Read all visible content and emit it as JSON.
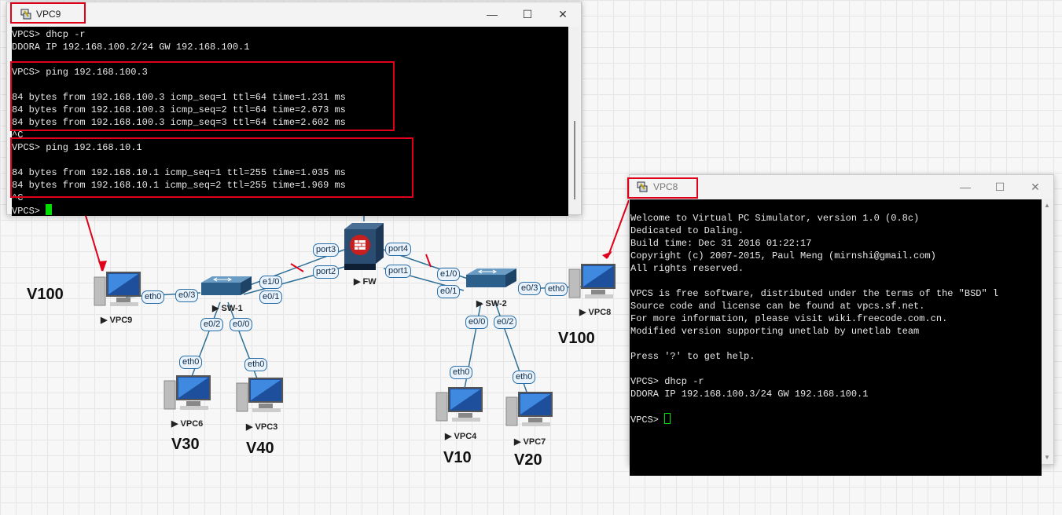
{
  "vpc9_window": {
    "title": "VPC9",
    "lines": [
      "VPCS> dhcp -r",
      "DDORA IP 192.168.100.2/24 GW 192.168.100.1",
      "",
      "VPCS> ping 192.168.100.3",
      "",
      "84 bytes from 192.168.100.3 icmp_seq=1 ttl=64 time=1.231 ms",
      "84 bytes from 192.168.100.3 icmp_seq=2 ttl=64 time=2.673 ms",
      "84 bytes from 192.168.100.3 icmp_seq=3 ttl=64 time=2.602 ms",
      "^C",
      "VPCS> ping 192.168.10.1",
      "",
      "84 bytes from 192.168.10.1 icmp_seq=1 ttl=255 time=1.035 ms",
      "84 bytes from 192.168.10.1 icmp_seq=2 ttl=255 time=1.969 ms",
      "^C"
    ],
    "prompt": "VPCS> ",
    "cursor_color": "#00dd00"
  },
  "vpc8_window": {
    "title": "VPC8",
    "lines": [
      "Welcome to Virtual PC Simulator, version 1.0 (0.8c)",
      "Dedicated to Daling.",
      "Build time: Dec 31 2016 01:22:17",
      "Copyright (c) 2007-2015, Paul Meng (mirnshi@gmail.com)",
      "All rights reserved.",
      "",
      "VPCS is free software, distributed under the terms of the \"BSD\" l",
      "Source code and license can be found at vpcs.sf.net.",
      "For more information, please visit wiki.freecode.com.cn.",
      "Modified version supporting unetlab by unetlab team",
      "",
      "Press '?' to get help.",
      "",
      "VPCS> dhcp -r",
      "DDORA IP 192.168.100.3/24 GW 192.168.100.1",
      ""
    ],
    "prompt": "VPCS> ",
    "cursor_color": "#00dd00"
  },
  "window_buttons": {
    "minimize": "—",
    "maximize": "☐",
    "close": "✕"
  },
  "topology": {
    "nodes": {
      "vpc9": "VPC9",
      "vpc8": "VPC8",
      "vpc6": "VPC6",
      "vpc3": "VPC3",
      "vpc4": "VPC4",
      "vpc7": "VPC7",
      "sw1": "SW-1",
      "sw2": "SW-2",
      "fw": "FW"
    },
    "ports": {
      "vpc9_eth0": "eth0",
      "sw1_e03": "e0/3",
      "sw1_e10": "e1/0",
      "sw1_e01": "e0/1",
      "sw1_e02": "e0/2",
      "sw1_e00": "e0/0",
      "vpc6_eth0": "eth0",
      "vpc3_eth0": "eth0",
      "fw_port3": "port3",
      "fw_port2": "port2",
      "fw_port4": "port4",
      "fw_port1": "port1",
      "sw2_e10": "e1/0",
      "sw2_e01": "e0/1",
      "sw2_e03": "e0/3",
      "vpc8_eth0": "eth0",
      "sw2_e00": "e0/0",
      "sw2_e02": "e0/2",
      "vpc4_eth0": "eth0",
      "vpc7_eth0": "eth0"
    },
    "vlans": {
      "vpc9": "V100",
      "vpc8": "V100",
      "vpc6": "V30",
      "vpc3": "V40",
      "vpc4": "V10",
      "vpc7": "V20"
    },
    "link_color": "#2f6f95",
    "annotation_color": "#e0001a"
  }
}
